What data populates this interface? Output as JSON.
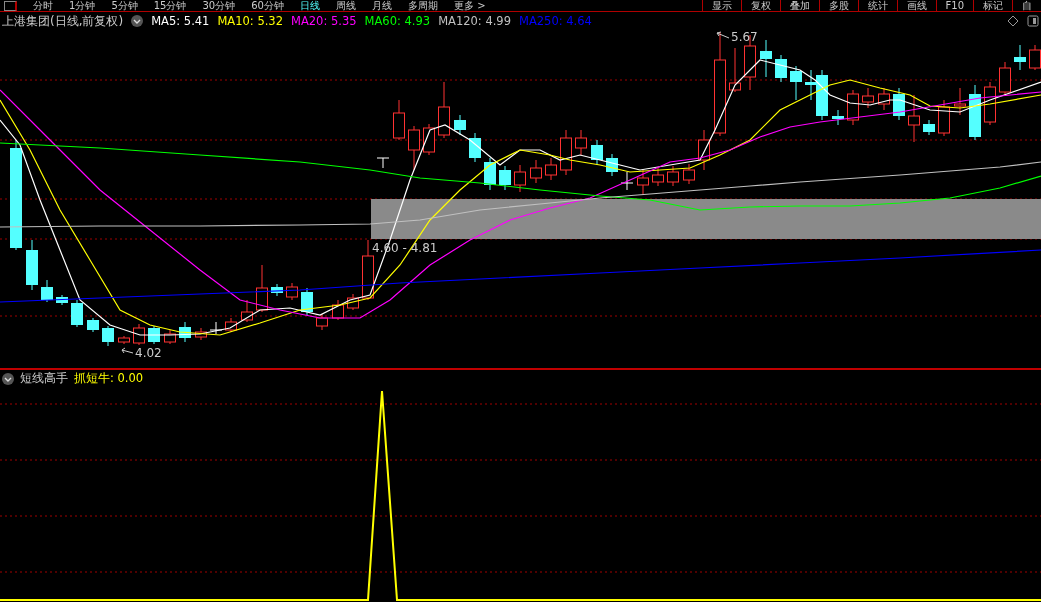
{
  "toolbar": {
    "periods": [
      {
        "label": "分时",
        "selected": false
      },
      {
        "label": "1分钟",
        "selected": false
      },
      {
        "label": "5分钟",
        "selected": false
      },
      {
        "label": "15分钟",
        "selected": false
      },
      {
        "label": "30分钟",
        "selected": false
      },
      {
        "label": "60分钟",
        "selected": false
      },
      {
        "label": "日线",
        "selected": true
      },
      {
        "label": "周线",
        "selected": false
      },
      {
        "label": "月线",
        "selected": false
      },
      {
        "label": "多周期",
        "selected": false
      },
      {
        "label": "更多 >",
        "selected": false
      }
    ],
    "buttons": [
      "显示",
      "复权",
      "叠加",
      "多股",
      "统计",
      "画线",
      "F10",
      "标记",
      "自"
    ]
  },
  "main_panel": {
    "title": "上港集团(日线,前复权)",
    "indicators": [
      {
        "label": "MA5: 5.41",
        "color": "#ffffff"
      },
      {
        "label": "MA10: 5.32",
        "color": "#ffff00"
      },
      {
        "label": "MA20: 5.35",
        "color": "#ff00ff"
      },
      {
        "label": "MA60: 4.93",
        "color": "#00ff00"
      },
      {
        "label": "MA120: 4.99",
        "color": "#c0c0c0"
      },
      {
        "label": "MA250: 4.64",
        "color": "#0000ff"
      }
    ],
    "high_label": "5.67",
    "low_label": "4.02",
    "range_label": "4.60 - 4.81"
  },
  "sub_panel": {
    "title": "短线高手",
    "indicators": [
      {
        "label": "抓短牛: 0.00",
        "color": "#ffff00"
      }
    ]
  }
}
